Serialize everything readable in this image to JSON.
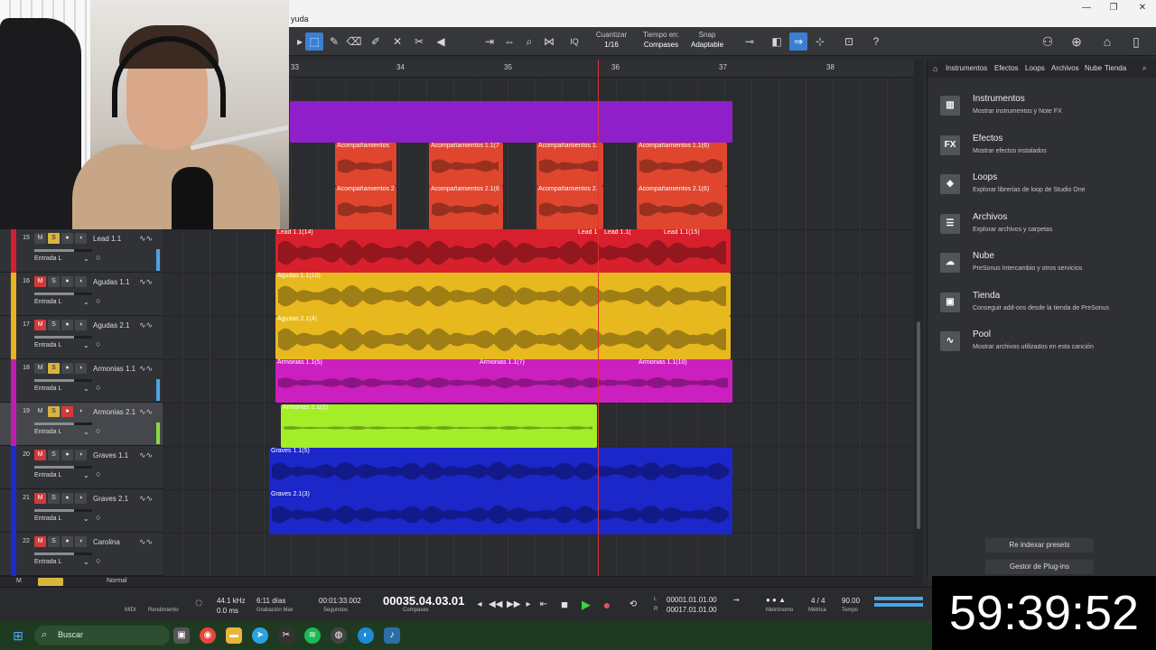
{
  "window": {
    "title_fragment": "yuda",
    "controls": [
      "—",
      "❐",
      "✕"
    ]
  },
  "toolbar": {
    "quantize_label": "Cuantizar",
    "quantize_value": "1/16",
    "timebase_label": "Tiempo en:",
    "timebase_value": "Compases",
    "snap_label": "Snap",
    "snap_value": "Adaptable",
    "iq": "IQ",
    "help": "?"
  },
  "ruler": {
    "bars": [
      "33",
      "34",
      "35",
      "36",
      "37",
      "38"
    ]
  },
  "tracks": [
    {
      "no": "15",
      "name": "Lead 1.1",
      "input": "Entrada L",
      "color": "#d0202c",
      "mute": false,
      "solo": true,
      "rec": false,
      "meter": "blue"
    },
    {
      "no": "16",
      "name": "Agudas 1.1",
      "input": "Entrada L",
      "color": "#e6b51e",
      "mute": true,
      "solo": false,
      "rec": false,
      "meter": ""
    },
    {
      "no": "17",
      "name": "Agudas 2.1",
      "input": "Entrada L",
      "color": "#e6b51e",
      "mute": true,
      "solo": false,
      "rec": false,
      "meter": ""
    },
    {
      "no": "18",
      "name": "Armonias 1.1",
      "input": "Entrada L",
      "color": "#c21bb0",
      "mute": false,
      "solo": true,
      "rec": false,
      "meter": "blue"
    },
    {
      "no": "19",
      "name": "Armonias 2.1",
      "input": "Entrada L",
      "color": "#c21bb0",
      "mute": false,
      "solo": true,
      "rec": true,
      "meter": "green"
    },
    {
      "no": "20",
      "name": "Graves 1.1",
      "input": "Entrada L",
      "color": "#1a2ccf",
      "mute": true,
      "solo": false,
      "rec": false,
      "meter": ""
    },
    {
      "no": "21",
      "name": "Graves 2.1",
      "input": "Entrada L",
      "color": "#1a2ccf",
      "mute": true,
      "solo": false,
      "rec": false,
      "meter": ""
    },
    {
      "no": "22",
      "name": "Carolina",
      "input": "Entrada L",
      "color": "#1a2ccf",
      "mute": true,
      "solo": false,
      "rec": false,
      "meter": ""
    }
  ],
  "track_buttons": {
    "mute": "M",
    "solo": "S",
    "rec": "●",
    "monitor": "◖",
    "input_chevron": "⌄",
    "wave": "∿∿"
  },
  "clips": {
    "acomp_top": [
      "Acompañamientos",
      "Acompañamientos 1.1(7",
      "Acompañamientos 1.",
      "Acompañamientos 1.1(6)"
    ],
    "acomp_bottom": [
      "Acompañamientos 2",
      "Acompañamientos 2.1(6",
      "Acompañamientos 2.",
      "Acompañamientos 2.1(6)"
    ],
    "lead": [
      "Lead 1.1(14)",
      "Lead 1.",
      "Lead 1.1(",
      "Lead 1.1(15)"
    ],
    "agudas1": "Agudas 1.1(10)",
    "agudas2": "Agudas 2.1(4)",
    "armonias1": [
      "Armonias 1.1(5)",
      "Armonias 1.1(7)",
      "Armonias 1.1(10)"
    ],
    "armonias2": "Armonias 2.1(2)",
    "graves1": "Graves 1.1(5)",
    "graves2": "Graves 2.1(3)"
  },
  "footer": {
    "m": "M",
    "mode": "Normal"
  },
  "browser": {
    "tabs": [
      "Instrumentos",
      "Efectos",
      "Loops",
      "Archivos",
      "Nube",
      "Tienda"
    ],
    "items": [
      {
        "title": "Instrumentos",
        "desc": "Mostrar instrumentos y Note FX",
        "icon": "piano-icon",
        "glyph": "▥"
      },
      {
        "title": "Efectos",
        "desc": "Mostrar efectos instalados",
        "icon": "fx-icon",
        "glyph": "FX"
      },
      {
        "title": "Loops",
        "desc": "Explorar librerías de loop de Studio One",
        "icon": "loops-icon",
        "glyph": "◈"
      },
      {
        "title": "Archivos",
        "desc": "Explorar archivos y carpetas",
        "icon": "files-icon",
        "glyph": "☰"
      },
      {
        "title": "Nube",
        "desc": "PreSonus Intercambio y otros servicios",
        "icon": "cloud-icon",
        "glyph": "☁"
      },
      {
        "title": "Tienda",
        "desc": "Conseguir add-ons desde la tienda de PreSonus",
        "icon": "store-icon",
        "glyph": "▣"
      },
      {
        "title": "Pool",
        "desc": "Mostrar archivos utilizados en esta canción",
        "icon": "pool-icon",
        "glyph": "∿"
      }
    ],
    "reindex": "Re indexar presets",
    "plugin_manager": "Gestor de Plug-ins"
  },
  "transport": {
    "midi": "MIDI",
    "performance": "Rendimiento",
    "sample_rate": "44.1 kHz",
    "latency": "0.0 ms",
    "record_time": "6:11 días",
    "record_max": "Grabación Max",
    "seconds_value": "00:01:33.002",
    "seconds_label": "Segundos",
    "position": "00035.04.03.01",
    "position_label": "Compases",
    "loop_l_label": "L",
    "loop_l": "00001.01.01.00",
    "loop_r_label": "R",
    "loop_r": "00017.01.01.00",
    "metronome": "Metrónomo",
    "signature": "4 / 4",
    "signature_label": "Métrica",
    "tempo": "90.00",
    "tempo_label": "Tempo"
  },
  "taskbar": {
    "search": "Buscar"
  },
  "timer": "59:39:52"
}
